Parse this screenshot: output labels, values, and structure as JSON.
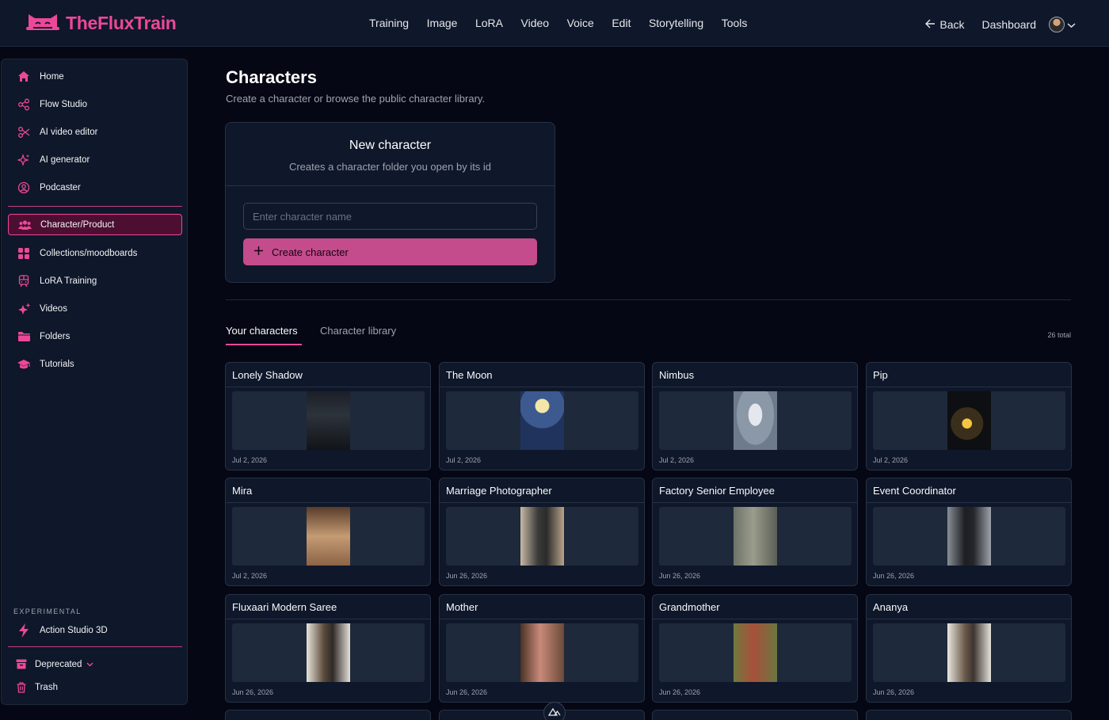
{
  "brand": {
    "name": "TheFluxTrain",
    "accent": "#ec4899"
  },
  "nav": {
    "links": [
      "Training",
      "Image",
      "LoRA",
      "Video",
      "Voice",
      "Edit",
      "Storytelling",
      "Tools"
    ],
    "back": "Back",
    "dashboard": "Dashboard"
  },
  "sidebar": {
    "items": [
      {
        "label": "Home",
        "icon": "home-icon"
      },
      {
        "label": "Flow Studio",
        "icon": "share-nodes-icon"
      },
      {
        "label": "AI video editor",
        "icon": "scissors-icon"
      },
      {
        "label": "AI generator",
        "icon": "sparkle-icon"
      },
      {
        "label": "Podcaster",
        "icon": "user-circle-icon"
      },
      {
        "label": "Character/Product",
        "icon": "users-icon",
        "active": true
      },
      {
        "label": "Collections/moodboards",
        "icon": "grid-icon"
      },
      {
        "label": "LoRA Training",
        "icon": "train-icon"
      },
      {
        "label": "Videos",
        "icon": "sparkles-icon"
      },
      {
        "label": "Folders",
        "icon": "folder-icon"
      },
      {
        "label": "Tutorials",
        "icon": "graduation-cap-icon"
      }
    ],
    "experimental_label": "EXPERIMENTAL",
    "experimental_item": "Action Studio 3D",
    "deprecated": "Deprecated",
    "trash": "Trash"
  },
  "page": {
    "title": "Characters",
    "subtitle": "Create a character or browse the public character library."
  },
  "new_character": {
    "title": "New character",
    "subtitle": "Creates a character folder you open by its id",
    "placeholder": "Enter character name",
    "button": "Create character"
  },
  "tabs": {
    "yours": "Your characters",
    "library": "Character library",
    "total": "26 total"
  },
  "characters": [
    {
      "name": "Lonely Shadow",
      "date": "Jul 2, 2026",
      "img": "linear-gradient(180deg,#1b1f27 0%,#2d333b 40%,#111418 100%)"
    },
    {
      "name": "The Moon",
      "date": "Jul 2, 2026",
      "img": "radial-gradient(circle at 50% 25%,#f5e6a8 0 14%,#3c5a8f 15% 45%,#1f335c 46%)"
    },
    {
      "name": "Nimbus",
      "date": "Jul 2, 2026",
      "img": "radial-gradient(ellipse at 50% 40%,#e4e8ee 0 22%,#8a98a8 23% 60%,#6d7b8c 61%)"
    },
    {
      "name": "Pip",
      "date": "Jul 2, 2026",
      "img": "radial-gradient(circle at 45% 55%,#f5c542 0 12%,#3a2f1a 13% 40%,#0d0f12 41%)"
    },
    {
      "name": "Mira",
      "date": "Jul 2, 2026",
      "img": "linear-gradient(180deg,#5a3c2a 0%,#c59b74 50%,#8c6445 100%)"
    },
    {
      "name": "Marriage Photographer",
      "date": "Jun 26, 2026",
      "img": "linear-gradient(90deg,#c8b9a4 0%,#3b3b3b 40%,#2b2b2b 60%,#b8a48a 100%)"
    },
    {
      "name": "Factory Senior Employee",
      "date": "Jun 26, 2026",
      "img": "linear-gradient(90deg,#6e7368 0%,#9a9c8d 45%,#5b5e54 100%)"
    },
    {
      "name": "Event Coordinator",
      "date": "Jun 26, 2026",
      "img": "linear-gradient(90deg,#8a8f96 0%,#1c1e22 40%,#23262b 60%,#9ea3aa 100%)"
    },
    {
      "name": "Fluxaari Modern Saree",
      "date": "Jun 26, 2026",
      "img": "linear-gradient(90deg,#e8e4dc 0%,#5b4a3a 40%,#2f2a28 60%,#e6e1d8 100%)"
    },
    {
      "name": "Mother",
      "date": "Jun 26, 2026",
      "img": "linear-gradient(90deg,#4a3326 0%,#c98a7a 45%,#6b4a38 100%)"
    },
    {
      "name": "Grandmother",
      "date": "Jun 26, 2026",
      "img": "linear-gradient(90deg,#6f7a3e 0%,#a8503a 45%,#6a7640 100%)"
    },
    {
      "name": "Ananya",
      "date": "Jun 26, 2026",
      "img": "linear-gradient(90deg,#e9e6e0 0%,#6b5a4a 40%,#3d3530 60%,#e5e2dc 100%)"
    }
  ]
}
